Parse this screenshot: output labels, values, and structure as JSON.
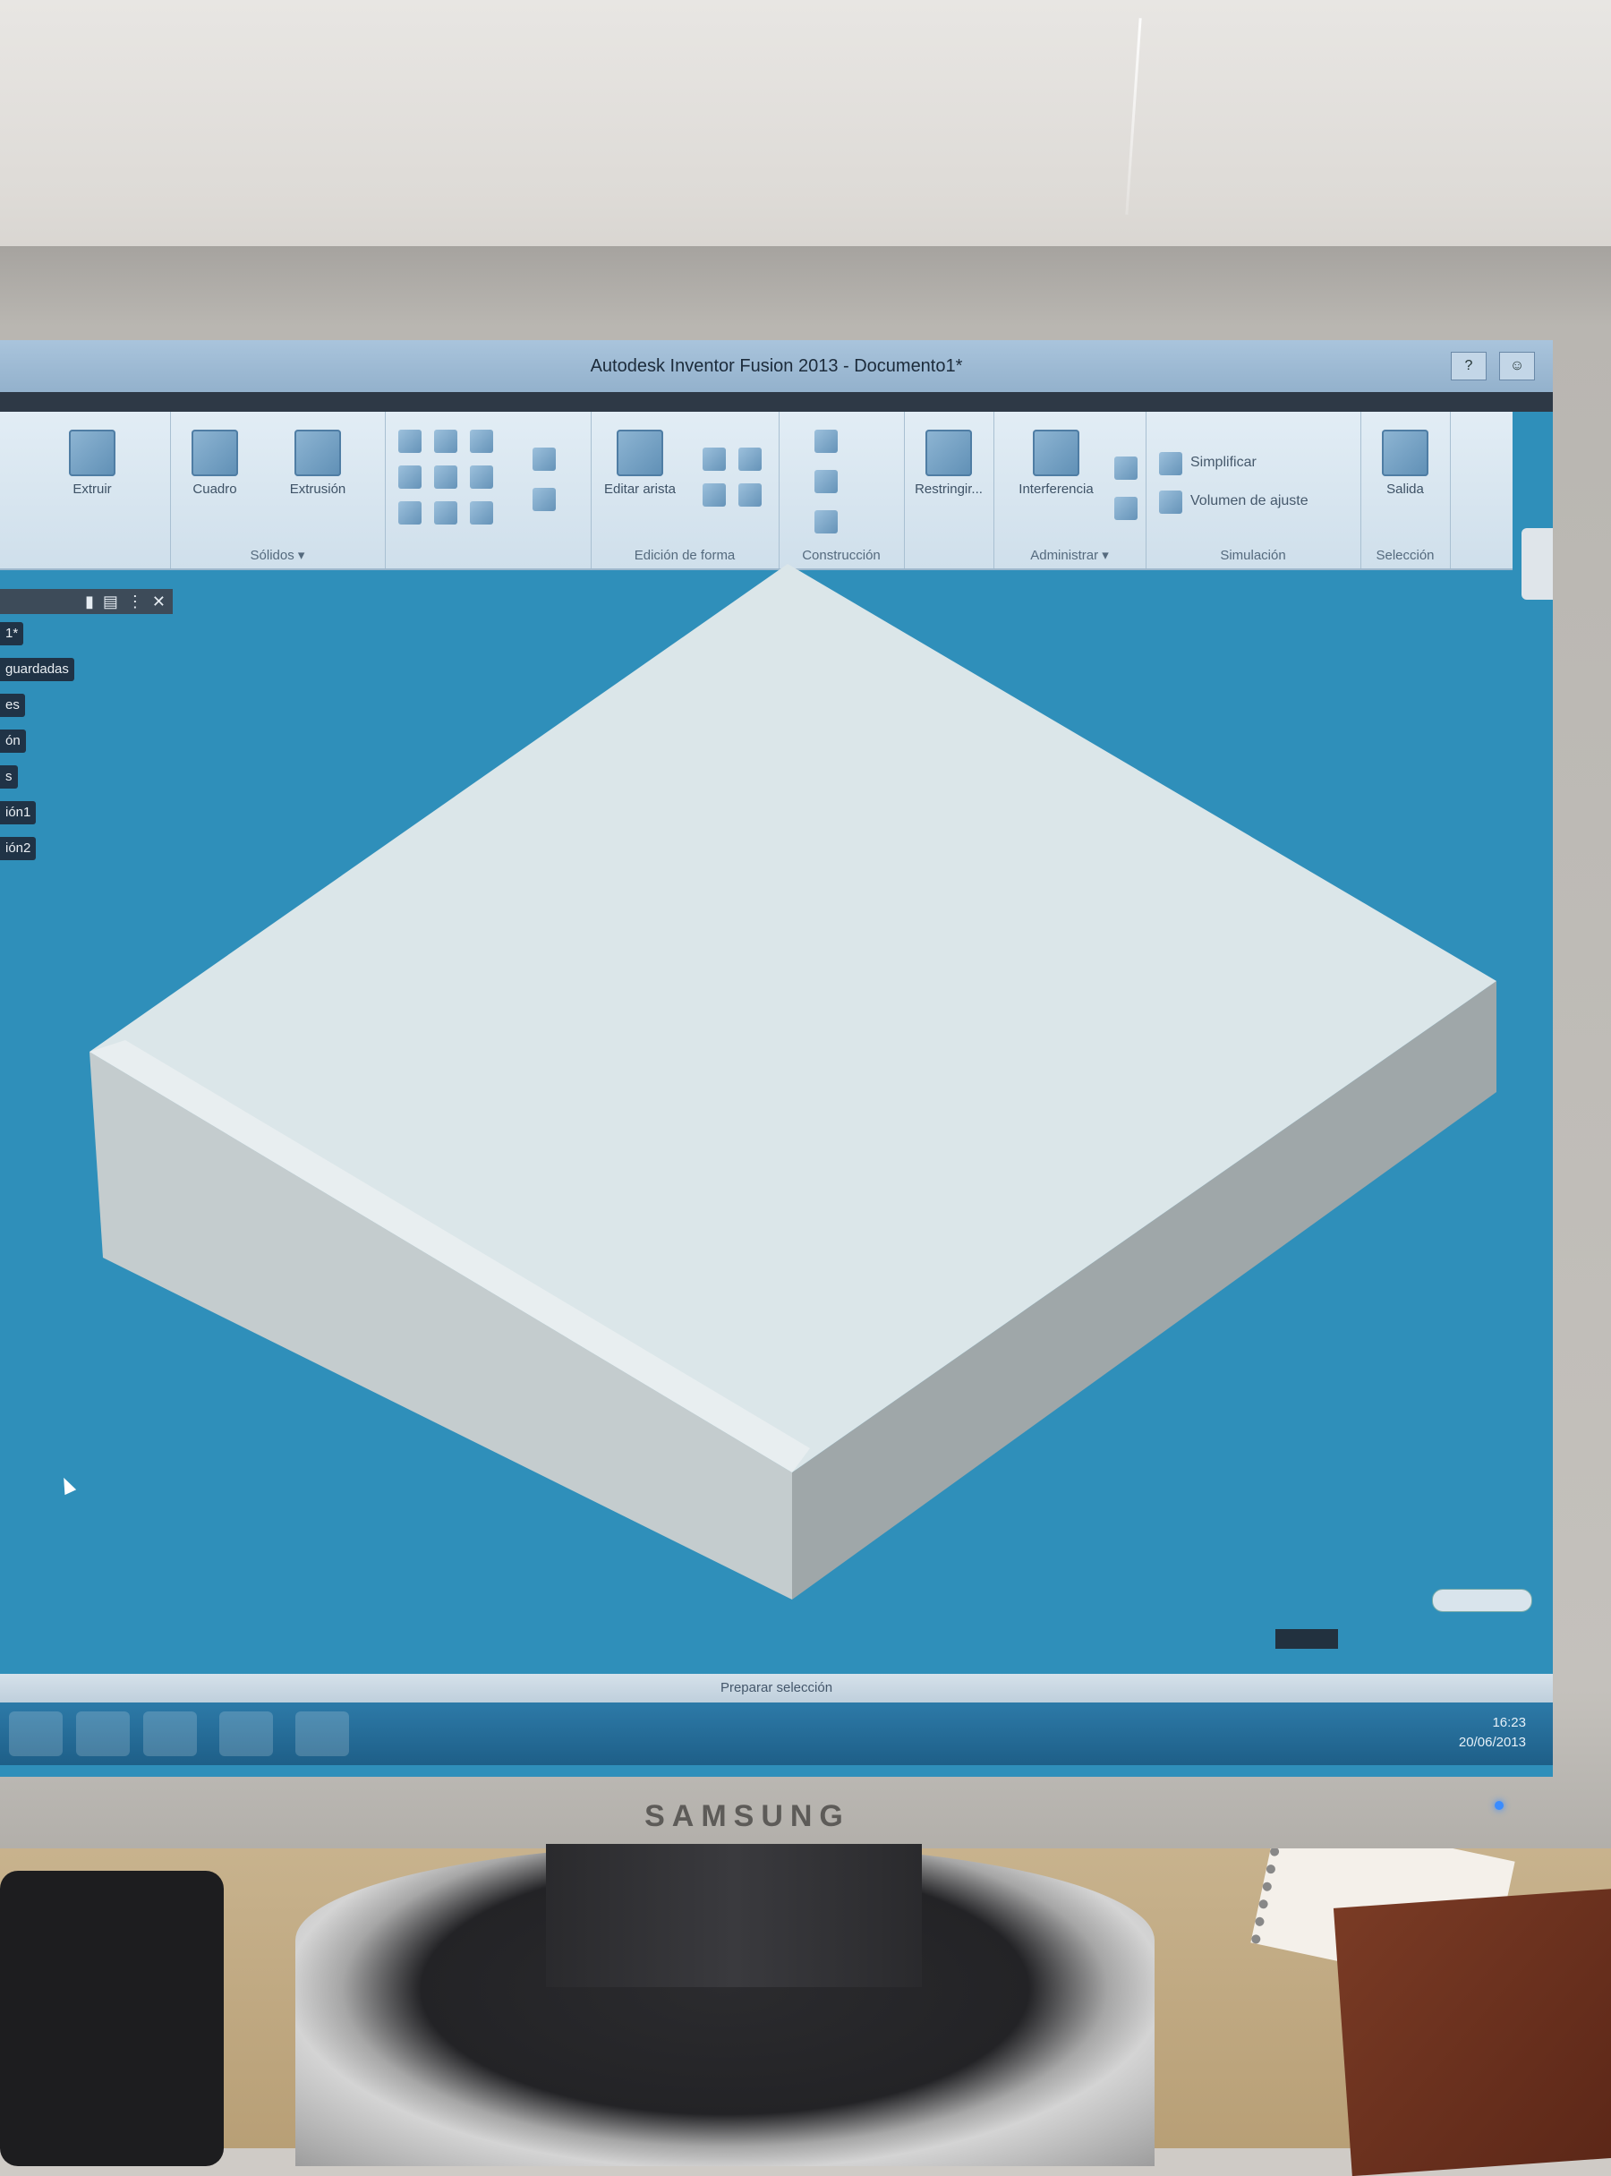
{
  "window": {
    "title": "Autodesk Inventor Fusion 2013 - Documento1*"
  },
  "ribbon": {
    "tools": [
      {
        "label": "Extruir"
      },
      {
        "label": "Cuadro"
      },
      {
        "label": "Extrusión"
      },
      {
        "label": "Editar arista"
      },
      {
        "label": "Restringir..."
      },
      {
        "label": "Interferencia"
      },
      {
        "label": "Simplificar"
      },
      {
        "label": "Volumen de ajuste"
      },
      {
        "label": "Salida"
      }
    ],
    "groups": [
      {
        "label": "Sólidos ▾"
      },
      {
        "label": "Edición de forma"
      },
      {
        "label": "Construcción"
      },
      {
        "label": "Administrar ▾"
      },
      {
        "label": "Simulación"
      },
      {
        "label": "Selección"
      }
    ]
  },
  "browser": {
    "items": [
      "1*",
      "guardadas",
      "es",
      "ón",
      "s",
      "ión1",
      "ión2"
    ]
  },
  "status": {
    "text": "Preparar selección"
  },
  "tray": {
    "time": "16:23",
    "date": "20/06/2013"
  },
  "bezel": {
    "brand": "SAMSUNG"
  },
  "colors": {
    "viewport": "#2f8fba",
    "model_top": "#dbe6e9",
    "model_left": "#c4ccce",
    "model_right": "#9fa7a9"
  },
  "icons": [
    "extrude-icon",
    "box-icon",
    "edit-edge-icon",
    "constraint-icon",
    "interference-icon",
    "simplify-icon",
    "close-icon",
    "pin-icon",
    "cursor-arrow-icon"
  ]
}
